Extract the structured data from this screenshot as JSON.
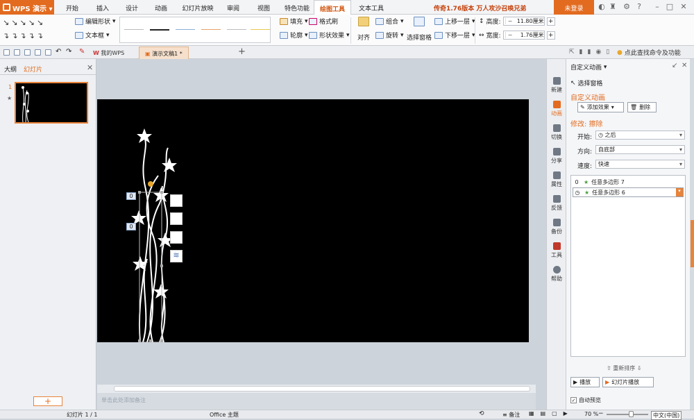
{
  "app": {
    "name": "WPS 演示"
  },
  "menu_tabs": [
    "开始",
    "插入",
    "设计",
    "动画",
    "幻灯片放映",
    "审阅",
    "视图",
    "特色功能",
    "绘图工具",
    "文本工具"
  ],
  "active_tab": "绘图工具",
  "promo_text": "传奇1.76版本 万人攻沙召唤兄弟",
  "login_label": "未登录",
  "ribbon": {
    "edit_shape": "编辑形状",
    "text_box": "文本框",
    "fill": "填充",
    "format_brush": "格式刷",
    "outline": "轮廓",
    "shape_effect": "形状效果",
    "align": "对齐",
    "group": "组合",
    "rotate": "旋转",
    "select_pane": "选择窗格",
    "bring_forward": "上移一层",
    "send_backward": "下移一层",
    "height_label": "高度:",
    "height_value": "11.80厘米",
    "width_label": "宽度:",
    "width_value": "1.76厘米",
    "find_command": "点此查找命令及功能"
  },
  "doc_tabs": {
    "my_wps": "我的WPS",
    "current_doc": "演示文稿1 *",
    "add": "+"
  },
  "left_panel": {
    "tab_outline": "大纲",
    "tab_slides": "幻灯片",
    "slide_number": "1",
    "add_slide": "+"
  },
  "slide_tags": [
    "0",
    "0"
  ],
  "notes_placeholder": "单击此处添加备注",
  "sidebar": [
    {
      "label": "新建",
      "icon": "new-icon"
    },
    {
      "label": "动画",
      "icon": "animation-icon"
    },
    {
      "label": "切换",
      "icon": "transition-icon"
    },
    {
      "label": "分享",
      "icon": "share-icon"
    },
    {
      "label": "属性",
      "icon": "property-icon"
    },
    {
      "label": "反馈",
      "icon": "feedback-icon"
    },
    {
      "label": "备份",
      "icon": "backup-icon"
    },
    {
      "label": "工具",
      "icon": "tools-icon"
    },
    {
      "label": "帮助",
      "icon": "help-icon"
    }
  ],
  "taskpane": {
    "title": "自定义动画",
    "select_pane": "选择窗格",
    "heading": "自定义动画",
    "add_effect": "添加效果",
    "delete": "删除",
    "modify": "修改: 擦除",
    "start_label": "开始:",
    "start_value": "之后",
    "direction_label": "方向:",
    "direction_value": "自底部",
    "speed_label": "速度:",
    "speed_value": "快速",
    "items": [
      {
        "index": "0",
        "name": "任意多边形 7"
      },
      {
        "index": "",
        "name": "任意多边形 6"
      }
    ],
    "reorder_label": "重新排序",
    "play": "播放",
    "slideshow": "幻灯片播放",
    "autopreview": "自动预览"
  },
  "status": {
    "slide_info": "幻灯片 1 / 1",
    "theme": "Office 主题",
    "notes": "备注",
    "zoom": "70 %",
    "input_method": "中文(中国)"
  },
  "colors": {
    "accent": "#e26b20",
    "slide_bg": "#000000"
  }
}
